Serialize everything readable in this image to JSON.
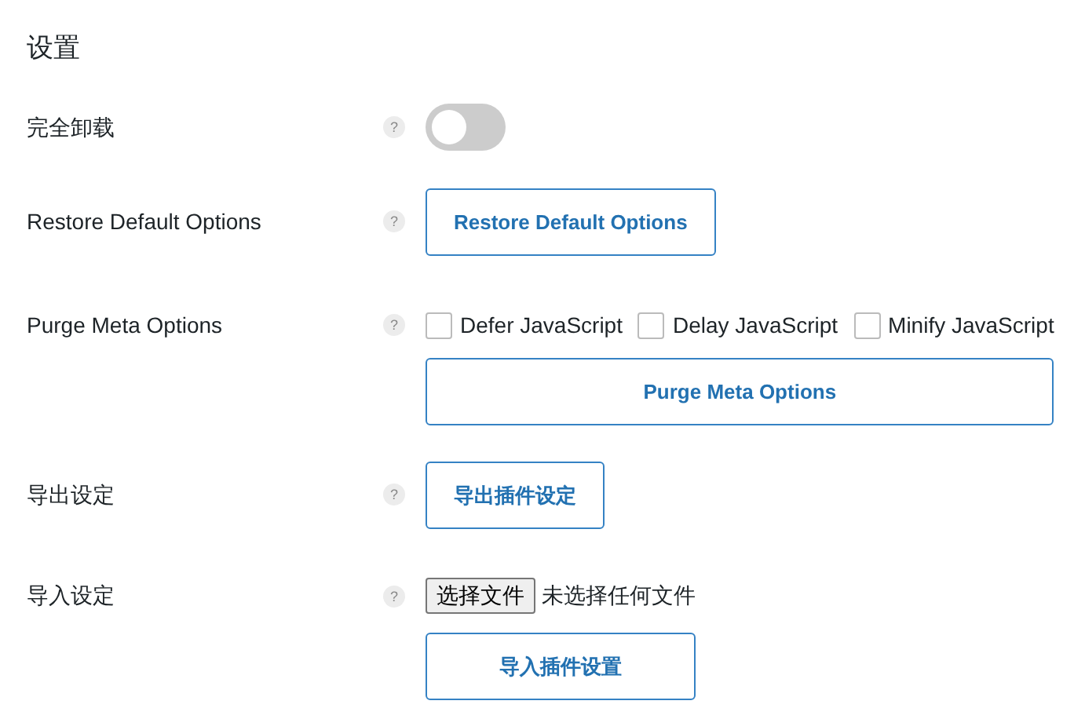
{
  "title": "设置",
  "rows": [
    {
      "kind": "toggle",
      "label": "完全卸载",
      "help": "?",
      "on": false
    },
    {
      "kind": "button",
      "label": "Restore Default Options",
      "help": "?",
      "button": "Restore Default Options"
    },
    {
      "kind": "checkboxes",
      "label": "Purge Meta Options",
      "help": "?",
      "options": [
        {
          "label": "Defer JavaScript",
          "checked": false
        },
        {
          "label": "Delay JavaScript",
          "checked": false
        },
        {
          "label": "Minify JavaScript",
          "checked": false
        }
      ],
      "button": "Purge Meta Options"
    },
    {
      "kind": "button",
      "label": "导出设定",
      "help": "?",
      "button": "导出插件设定"
    },
    {
      "kind": "file",
      "label": "导入设定",
      "help": "?",
      "file_button": "选择文件",
      "file_status": "未选择任何文件",
      "button": "导入插件设置"
    }
  ]
}
